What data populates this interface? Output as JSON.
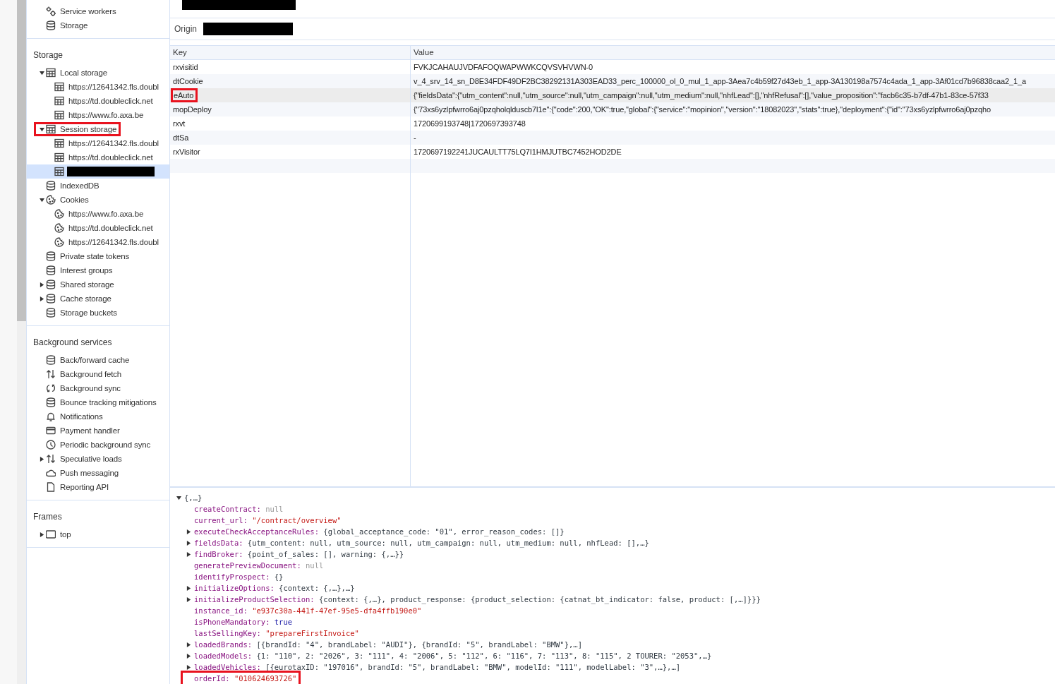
{
  "sidebar": {
    "top_items": [
      {
        "label": "Service workers",
        "kind": "gear",
        "selected": false
      },
      {
        "label": "Storage",
        "kind": "database",
        "selected": false
      }
    ],
    "sections": [
      {
        "title": "Storage",
        "items": [
          {
            "label": "Local storage",
            "kind": "table",
            "expanded": true,
            "selected": false,
            "highlighted": false,
            "children": [
              {
                "label": "https://12641342.fls.doubl",
                "kind": "table",
                "selected": false
              },
              {
                "label": "https://td.doubleclick.net",
                "kind": "table",
                "selected": false
              },
              {
                "label": "https://www.fo.axa.be",
                "kind": "table",
                "selected": false
              }
            ]
          },
          {
            "label": "Session storage",
            "kind": "table",
            "expanded": true,
            "selected": false,
            "highlighted": true,
            "children": [
              {
                "label": "https://12641342.fls.doubl",
                "kind": "table",
                "selected": false
              },
              {
                "label": "https://td.doubleclick.net",
                "kind": "table",
                "selected": false
              },
              {
                "redacted": true,
                "kind": "table",
                "selected": true
              }
            ]
          },
          {
            "label": "IndexedDB",
            "kind": "database",
            "selected": false,
            "highlighted": false
          },
          {
            "label": "Cookies",
            "kind": "cookie",
            "expanded": true,
            "selected": false,
            "highlighted": false,
            "children": [
              {
                "label": "https://www.fo.axa.be",
                "kind": "cookie",
                "selected": false
              },
              {
                "label": "https://td.doubleclick.net",
                "kind": "cookie",
                "selected": false
              },
              {
                "label": "https://12641342.fls.doubl",
                "kind": "cookie",
                "selected": false
              }
            ]
          },
          {
            "label": "Private state tokens",
            "kind": "database",
            "selected": false,
            "highlighted": false
          },
          {
            "label": "Interest groups",
            "kind": "database",
            "selected": false,
            "highlighted": false
          },
          {
            "label": "Shared storage",
            "kind": "database",
            "expanded": false,
            "selected": false,
            "highlighted": false
          },
          {
            "label": "Cache storage",
            "kind": "database",
            "expanded": false,
            "selected": false,
            "highlighted": false
          },
          {
            "label": "Storage buckets",
            "kind": "database",
            "selected": false,
            "highlighted": false
          }
        ]
      },
      {
        "title": "Background services",
        "items": [
          {
            "label": "Back/forward cache",
            "kind": "database",
            "selected": false,
            "highlighted": false
          },
          {
            "label": "Background fetch",
            "kind": "updown",
            "selected": false,
            "highlighted": false
          },
          {
            "label": "Background sync",
            "kind": "sync",
            "selected": false,
            "highlighted": false
          },
          {
            "label": "Bounce tracking mitigations",
            "kind": "database",
            "selected": false,
            "highlighted": false
          },
          {
            "label": "Notifications",
            "kind": "bell",
            "selected": false,
            "highlighted": false
          },
          {
            "label": "Payment handler",
            "kind": "card",
            "selected": false,
            "highlighted": false
          },
          {
            "label": "Periodic background sync",
            "kind": "clock",
            "selected": false,
            "highlighted": false
          },
          {
            "label": "Speculative loads",
            "kind": "updown",
            "expanded": false,
            "selected": false,
            "highlighted": false
          },
          {
            "label": "Push messaging",
            "kind": "cloud",
            "selected": false,
            "highlighted": false
          },
          {
            "label": "Reporting API",
            "kind": "document",
            "selected": false,
            "highlighted": false
          }
        ]
      },
      {
        "title": "Frames",
        "items": [
          {
            "label": "top",
            "kind": "frame",
            "expanded": false,
            "selected": false,
            "highlighted": false
          }
        ]
      }
    ]
  },
  "origin": {
    "label": "Origin"
  },
  "table": {
    "columns": [
      "Key",
      "Value"
    ],
    "rows": [
      {
        "key": "rxvisitid",
        "value": "FVKJCAHAUJVDFAFOQWAPWWKCQVSVHVWN-0",
        "selected": false,
        "highlighted": false
      },
      {
        "key": "dtCookie",
        "value": "v_4_srv_14_sn_D8E34FDF49DF2BC38292131A303EAD33_perc_100000_ol_0_mul_1_app-3Aea7c4b59f27d43eb_1_app-3A130198a7574c4ada_1_app-3Af01cd7b96838caa2_1_a",
        "selected": false,
        "highlighted": false
      },
      {
        "key": "eAuto",
        "value": "{\"fieldsData\":{\"utm_content\":null,\"utm_source\":null,\"utm_campaign\":null,\"utm_medium\":null,\"nhfLead\":[],\"nhfRefusal\":[],\"value_proposition\":\"facb6c35-b7df-47b1-83ce-57f33",
        "selected": true,
        "highlighted": true
      },
      {
        "key": "mopDeploy",
        "value": "{\"73xs6yzlpfwrro6aj0pzqholqlduscb7l1e\":{\"code\":200,\"OK\":true,\"global\":{\"service\":\"mopinion\",\"version\":\"18082023\",\"stats\":true},\"deployment\":{\"id\":\"73xs6yzlpfwrro6aj0pzqho",
        "selected": false,
        "highlighted": false
      },
      {
        "key": "rxvt",
        "value": "1720699193748|1720697393748",
        "selected": false,
        "highlighted": false
      },
      {
        "key": "dtSa",
        "value": "-",
        "selected": false,
        "highlighted": false
      },
      {
        "key": "rxVisitor",
        "value": "1720697192241JUCAULTT75LQ7I1HMJUTBC7452HOD2DE",
        "selected": false,
        "highlighted": false
      }
    ]
  },
  "preview": {
    "root": "{,…}",
    "root_expanded": true,
    "lines": [
      {
        "name": "createContract:",
        "value": "null",
        "kind": "null",
        "highlighted": false
      },
      {
        "name": "current_url:",
        "value": "\"/contract/overview\"",
        "kind": "string",
        "highlighted": false
      },
      {
        "name": "executeCheckAcceptanceRules:",
        "value": "{global_acceptance_code: \"01\", error_reason_codes: []}",
        "kind": "object",
        "expanded": false,
        "highlighted": false
      },
      {
        "name": "fieldsData:",
        "value": "{utm_content: null, utm_source: null, utm_campaign: null, utm_medium: null, nhfLead: [],…}",
        "kind": "object",
        "expanded": false,
        "highlighted": false
      },
      {
        "name": "findBroker:",
        "value": "{point_of_sales: [], warning: {,…}}",
        "kind": "object",
        "expanded": false,
        "highlighted": false
      },
      {
        "name": "generatePreviewDocument:",
        "value": "null",
        "kind": "null",
        "highlighted": false
      },
      {
        "name": "identifyProspect:",
        "value": "{}",
        "kind": "object",
        "highlighted": false
      },
      {
        "name": "initializeOptions:",
        "value": "{context: {,…},…}",
        "kind": "object",
        "expanded": false,
        "highlighted": false
      },
      {
        "name": "initializeProductSelection:",
        "value": "{context: {,…}, product_response: {product_selection: {catnat_bt_indicator: false, product: [,…]}}}",
        "kind": "object",
        "expanded": false,
        "highlighted": false
      },
      {
        "name": "instance_id:",
        "value": "\"e937c30a-441f-47ef-95e5-dfa4ffb190e0\"",
        "kind": "string",
        "highlighted": false
      },
      {
        "name": "isPhoneMandatory:",
        "value": "true",
        "kind": "bool",
        "highlighted": false
      },
      {
        "name": "lastSellingKey:",
        "value": "\"prepareFirstInvoice\"",
        "kind": "string",
        "highlighted": false
      },
      {
        "name": "loadedBrands:",
        "value": "[{brandId: \"4\", brandLabel: \"AUDI\"}, {brandId: \"5\", brandLabel: \"BMW\"},…]",
        "kind": "object",
        "expanded": false,
        "highlighted": false
      },
      {
        "name": "loadedModels:",
        "value": "{1: \"110\", 2: \"2026\", 3: \"111\", 4: \"2006\", 5: \"112\", 6: \"116\", 7: \"113\", 8: \"115\", 2 TOURER: \"2053\",…}",
        "kind": "object",
        "expanded": false,
        "highlighted": false
      },
      {
        "name": "loadedVehicles:",
        "value": "[{eurotaxID: \"197016\", brandId: \"5\", brandLabel: \"BMW\", modelId: \"111\", modelLabel: \"3\",…},…]",
        "kind": "object",
        "expanded": false,
        "highlighted": false
      },
      {
        "name": "orderId:",
        "value": "\"010624693726\"",
        "kind": "string",
        "highlighted": true
      }
    ]
  }
}
